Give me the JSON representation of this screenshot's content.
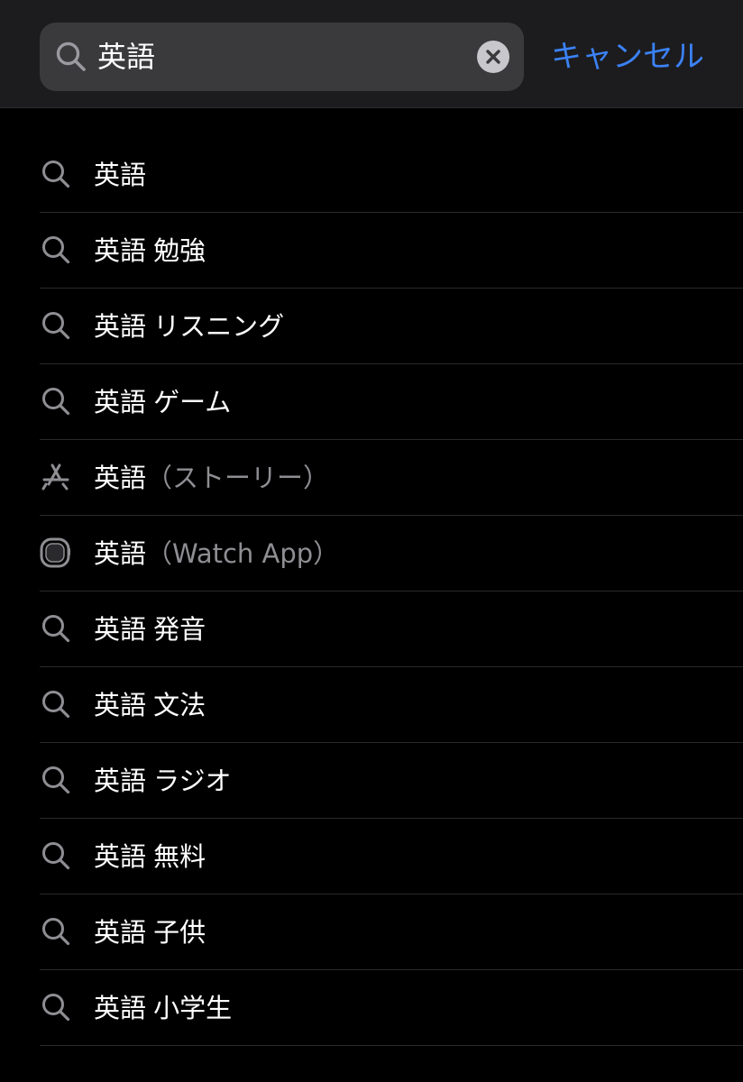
{
  "search": {
    "query": "英語",
    "cancel_label": "キャンセル"
  },
  "suggestions": [
    {
      "term": "英語",
      "extra": "",
      "suffix": "",
      "icon": "search-icon"
    },
    {
      "term": "英語",
      "extra": "勉強",
      "suffix": "",
      "icon": "search-icon"
    },
    {
      "term": "英語",
      "extra": "リスニング",
      "suffix": "",
      "icon": "search-icon"
    },
    {
      "term": "英語",
      "extra": "ゲーム",
      "suffix": "",
      "icon": "search-icon"
    },
    {
      "term": "英語",
      "extra": "",
      "suffix": "（ストーリー）",
      "icon": "app-store-icon"
    },
    {
      "term": "英語",
      "extra": "",
      "suffix": "（Watch App）",
      "icon": "apple-watch-icon"
    },
    {
      "term": "英語",
      "extra": "発音",
      "suffix": "",
      "icon": "search-icon"
    },
    {
      "term": "英語",
      "extra": "文法",
      "suffix": "",
      "icon": "search-icon"
    },
    {
      "term": "英語",
      "extra": "ラジオ",
      "suffix": "",
      "icon": "search-icon"
    },
    {
      "term": "英語",
      "extra": "無料",
      "suffix": "",
      "icon": "search-icon"
    },
    {
      "term": "英語",
      "extra": "子供",
      "suffix": "",
      "icon": "search-icon"
    },
    {
      "term": "英語",
      "extra": "小学生",
      "suffix": "",
      "icon": "search-icon"
    }
  ],
  "colors": {
    "background": "#000000",
    "bar": "#1c1c1e",
    "field": "#3a3a3c",
    "accent": "#3b82f6",
    "muted": "#8e8e93",
    "icon": "#8e8e93"
  }
}
